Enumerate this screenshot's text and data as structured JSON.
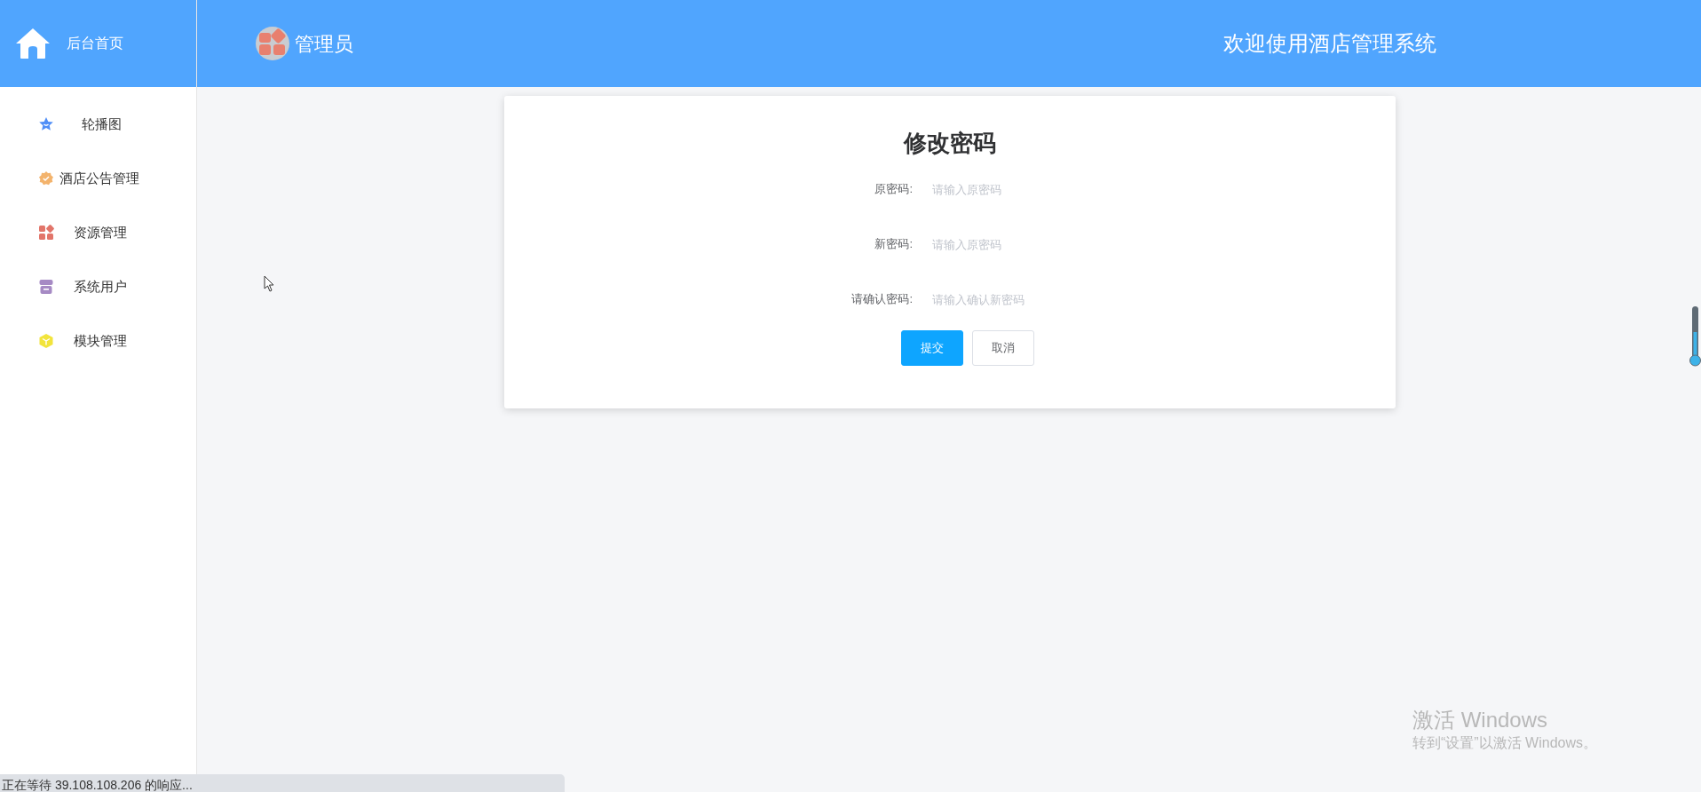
{
  "sidebar": {
    "home": "后台首页",
    "items": [
      {
        "label": "轮播图",
        "color": "#4f8ef7"
      },
      {
        "label": "酒店公告管理",
        "color": "#f3b36c"
      },
      {
        "label": "资源管理",
        "color": "#e2756a"
      },
      {
        "label": "系统用户",
        "color": "#a68ac4"
      },
      {
        "label": "模块管理",
        "color": "#f2e43c"
      }
    ]
  },
  "header": {
    "user": "管理员",
    "welcome": "欢迎使用酒店管理系统"
  },
  "form": {
    "title": "修改密码",
    "fields": [
      {
        "label": "原密码:",
        "placeholder": "请输入原密码"
      },
      {
        "label": "新密码:",
        "placeholder": "请输入原密码"
      },
      {
        "label": "请确认密码:",
        "placeholder": "请输入确认新密码"
      }
    ],
    "buttons": [
      {
        "label": "提交",
        "kind": "primary"
      },
      {
        "label": "取消",
        "kind": "default"
      }
    ]
  },
  "status_bar": "正在等待 39.108.108.206 的响应...",
  "windows_activation": {
    "title": "激活 Windows",
    "subtitle": "转到“设置”以激活 Windows。"
  }
}
